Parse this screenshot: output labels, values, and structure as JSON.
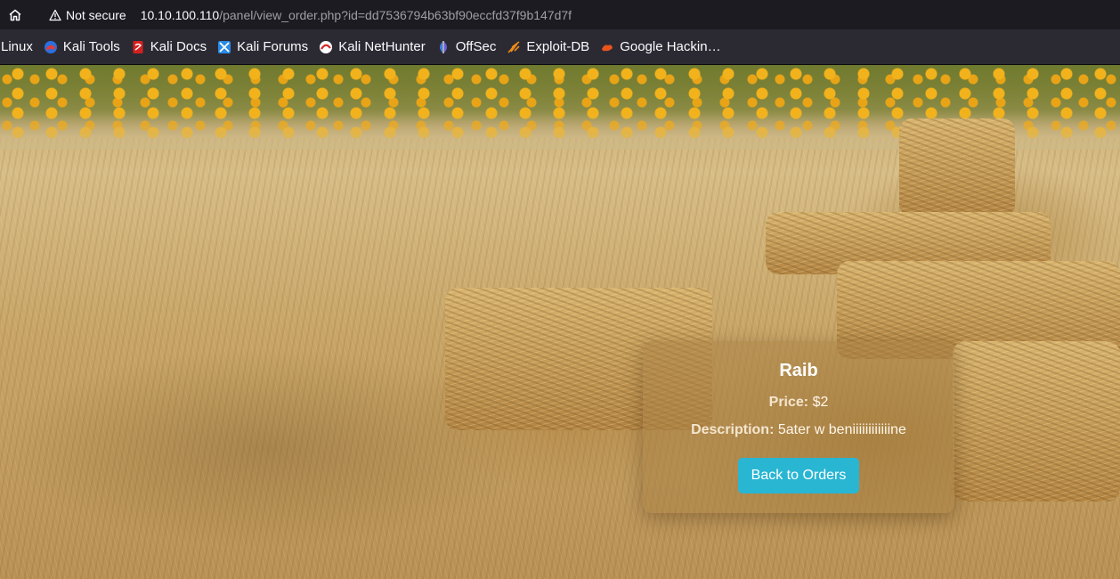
{
  "browser": {
    "security_label": "Not secure",
    "url_host": "10.10.100.110",
    "url_path": "/panel/view_order.php?id=dd7536794b63bf90eccfd37f9b147d7f"
  },
  "bookmarks": [
    {
      "label": "Linux",
      "icon": "none"
    },
    {
      "label": "Kali Tools",
      "icon": "kali-tools-icon"
    },
    {
      "label": "Kali Docs",
      "icon": "kali-docs-icon"
    },
    {
      "label": "Kali Forums",
      "icon": "kali-forums-icon"
    },
    {
      "label": "Kali NetHunter",
      "icon": "kali-nethunter-icon"
    },
    {
      "label": "OffSec",
      "icon": "offsec-icon"
    },
    {
      "label": "Exploit-DB",
      "icon": "exploit-db-icon"
    },
    {
      "label": "Google Hackin…",
      "icon": "google-hacking-icon"
    }
  ],
  "order": {
    "name": "Raib",
    "price_label": "Price:",
    "price_value": "$2",
    "description_label": "Description:",
    "description_value": "5ater w beniiiiiiiiiiiine",
    "back_button_label": "Back to Orders"
  },
  "colors": {
    "accent_button": "#29b6d3",
    "chrome_dark": "#1c1b22",
    "bookmarks_bar": "#2b2a33"
  }
}
